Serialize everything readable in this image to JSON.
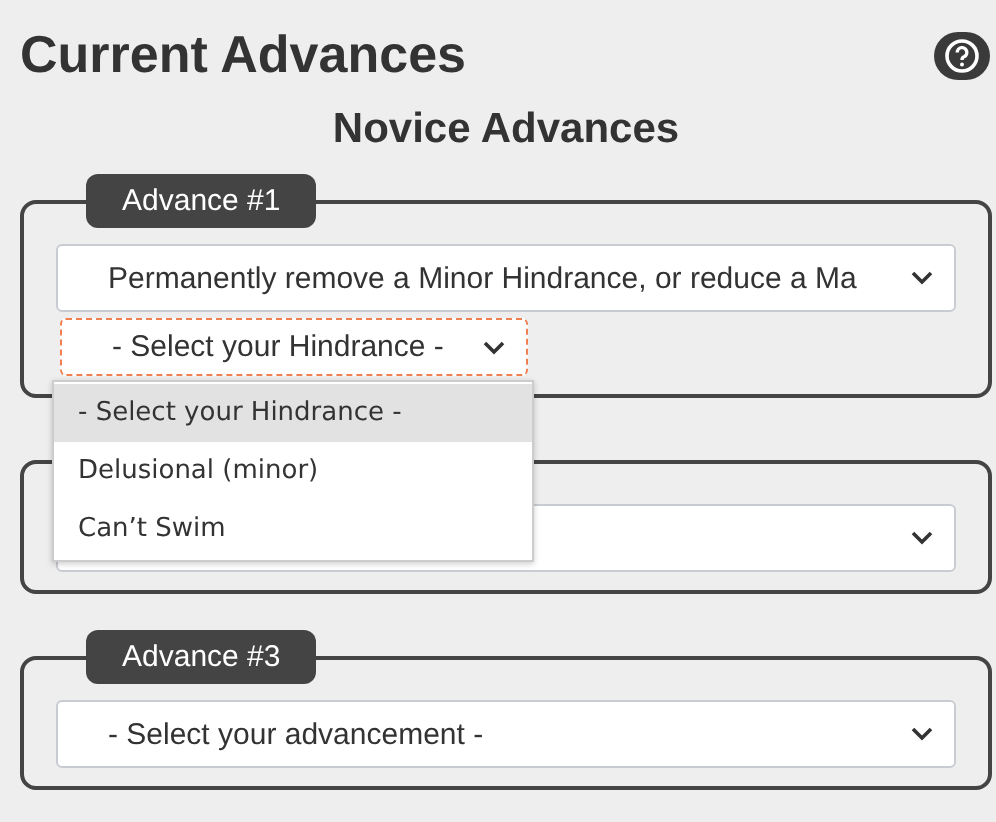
{
  "title": "Current Advances",
  "section_title": "Novice Advances",
  "advances": [
    {
      "kind": "select",
      "legend": "Advance #1",
      "value": "Permanently remove a Minor Hindrance, or reduce a Ma",
      "sub_select": {
        "value": "- Select your Hindrance -",
        "focused": true,
        "options": [
          {
            "label": "- Select your Hindrance -",
            "selected": true
          },
          {
            "label": "Delusional (minor)",
            "selected": false
          },
          {
            "label": "Can’t Swim",
            "selected": false
          }
        ]
      }
    },
    {
      "kind": "select"
    },
    {
      "kind": "select",
      "legend": "Advance #3",
      "value": "- Select your advancement -"
    }
  ]
}
